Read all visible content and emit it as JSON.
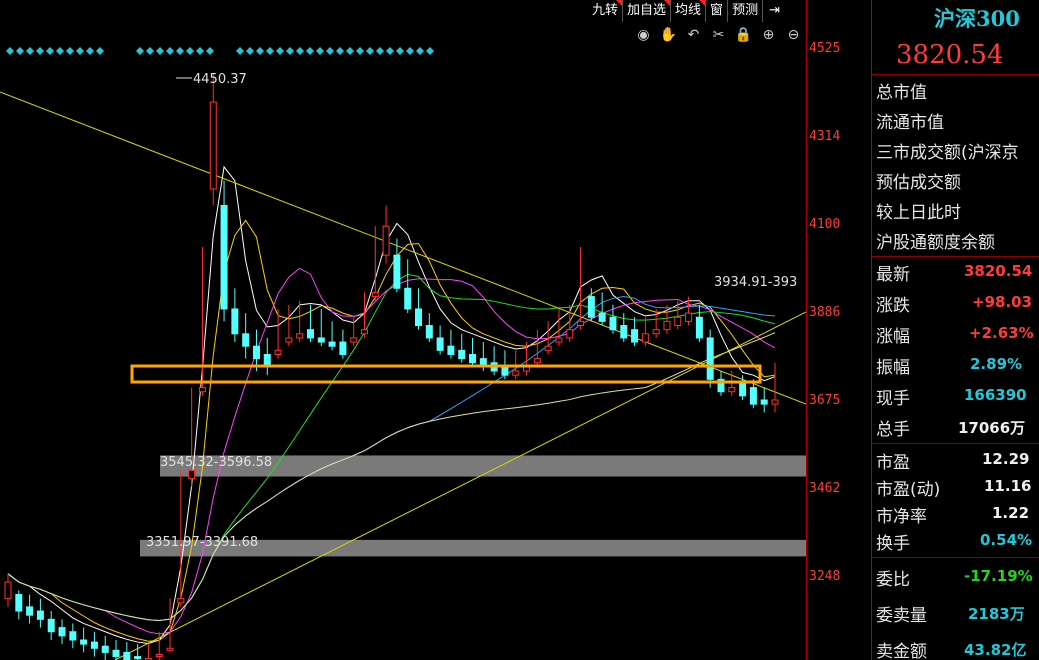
{
  "toolbar": {
    "buttons": [
      "九转",
      "加自选",
      "均线",
      "窗",
      "预测"
    ],
    "exit_icon": "exit-arrow-icon"
  },
  "icons": [
    "eye-icon",
    "hand-icon",
    "undo-icon",
    "cut-icon",
    "lock-icon",
    "zoom-in-icon",
    "zoom-out-icon"
  ],
  "price_axis": {
    "ticks": [
      "4525",
      "4314",
      "4100",
      "3886",
      "3675",
      "3462",
      "3248"
    ]
  },
  "annotations": {
    "high_label": "4450.37",
    "ma_label": "3934.91-393",
    "zone_upper": "3545.32-3596.58",
    "zone_lower": "3351.97-3391.68"
  },
  "colors": {
    "up": "#ff3030",
    "down": "#54ffff",
    "trendline": "#d8d800",
    "highlight": "#ffa500"
  },
  "chart_data": {
    "type": "candlestick",
    "ylim": [
      3150,
      4600
    ],
    "candles": [
      [
        3290,
        3310,
        3250,
        3230
      ],
      [
        3260,
        3270,
        3220,
        3200
      ],
      [
        3230,
        3260,
        3210,
        3190
      ],
      [
        3220,
        3250,
        3200,
        3180
      ],
      [
        3200,
        3220,
        3170,
        3150
      ],
      [
        3180,
        3200,
        3160,
        3140
      ],
      [
        3170,
        3190,
        3150,
        3130
      ],
      [
        3150,
        3180,
        3140,
        3120
      ],
      [
        3145,
        3170,
        3130,
        3110
      ],
      [
        3135,
        3160,
        3120,
        3100
      ],
      [
        3125,
        3150,
        3110,
        3095
      ],
      [
        3120,
        3145,
        3100,
        3090
      ],
      [
        3110,
        3140,
        3105,
        3090
      ],
      [
        3105,
        3140,
        3100,
        3085
      ],
      [
        3115,
        3170,
        3110,
        3100
      ],
      [
        3130,
        3250,
        3125,
        3120
      ],
      [
        3250,
        3560,
        3240,
        3230
      ],
      [
        3560,
        3760,
        3540,
        3520
      ],
      [
        3760,
        4100,
        3750,
        3740
      ],
      [
        4450,
        4520,
        4240,
        4200
      ],
      [
        4200,
        4260,
        3950,
        3920
      ],
      [
        3950,
        4000,
        3890,
        3870
      ],
      [
        3890,
        3940,
        3860,
        3830
      ],
      [
        3860,
        3900,
        3830,
        3800
      ],
      [
        3840,
        3880,
        3810,
        3790
      ],
      [
        3850,
        3950,
        3840,
        3830
      ],
      [
        3880,
        3960,
        3870,
        3860
      ],
      [
        3890,
        3970,
        3880,
        3870
      ],
      [
        3900,
        3960,
        3880,
        3870
      ],
      [
        3880,
        3950,
        3870,
        3860
      ],
      [
        3870,
        3920,
        3860,
        3850
      ],
      [
        3870,
        3900,
        3840,
        3830
      ],
      [
        3880,
        3930,
        3870,
        3860
      ],
      [
        3900,
        3990,
        3890,
        3880
      ],
      [
        3990,
        4150,
        3980,
        3970
      ],
      [
        4150,
        4200,
        4080,
        4060
      ],
      [
        4080,
        4120,
        4000,
        3990
      ],
      [
        4000,
        4070,
        3950,
        3940
      ],
      [
        3950,
        4000,
        3910,
        3900
      ],
      [
        3910,
        3940,
        3880,
        3870
      ],
      [
        3880,
        3910,
        3850,
        3840
      ],
      [
        3860,
        3900,
        3840,
        3830
      ],
      [
        3850,
        3890,
        3830,
        3820
      ],
      [
        3840,
        3880,
        3820,
        3810
      ],
      [
        3830,
        3870,
        3810,
        3800
      ],
      [
        3820,
        3860,
        3800,
        3790
      ],
      [
        3810,
        3850,
        3790,
        3780
      ],
      [
        3800,
        3850,
        3790,
        3780
      ],
      [
        3810,
        3870,
        3800,
        3790
      ],
      [
        3830,
        3900,
        3820,
        3810
      ],
      [
        3860,
        3920,
        3850,
        3840
      ],
      [
        3880,
        3950,
        3870,
        3860
      ],
      [
        3900,
        3960,
        3880,
        3870
      ],
      [
        3920,
        4100,
        3910,
        3900
      ],
      [
        3980,
        4000,
        3930,
        3920
      ],
      [
        3940,
        3990,
        3920,
        3910
      ],
      [
        3930,
        3960,
        3900,
        3890
      ],
      [
        3910,
        3940,
        3880,
        3870
      ],
      [
        3900,
        3930,
        3870,
        3860
      ],
      [
        3890,
        3930,
        3870,
        3860
      ],
      [
        3900,
        3950,
        3890,
        3880
      ],
      [
        3920,
        3960,
        3900,
        3890
      ],
      [
        3930,
        3970,
        3910,
        3900
      ],
      [
        3940,
        3980,
        3920,
        3910
      ],
      [
        3930,
        3960,
        3880,
        3870
      ],
      [
        3880,
        3900,
        3780,
        3760
      ],
      [
        3780,
        3800,
        3750,
        3740
      ],
      [
        3760,
        3800,
        3750,
        3740
      ],
      [
        3770,
        3790,
        3740,
        3730
      ],
      [
        3760,
        3780,
        3720,
        3710
      ],
      [
        3730,
        3760,
        3720,
        3700
      ],
      [
        3730,
        3820,
        3720,
        3700
      ]
    ]
  }
}
